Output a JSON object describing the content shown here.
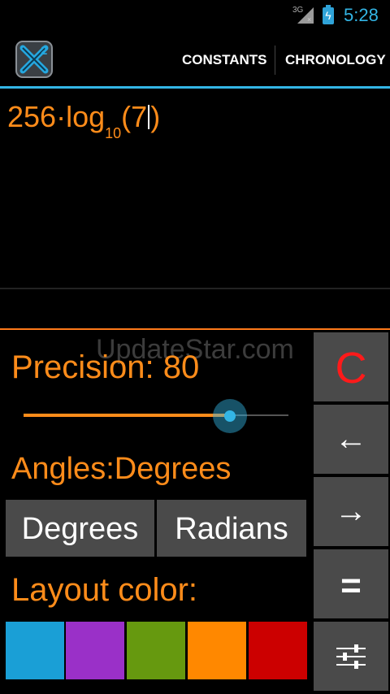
{
  "status_bar": {
    "network": "3G",
    "time": "5:28"
  },
  "action_bar": {
    "constants_label": "CONSTANTS",
    "chronology_label": "CHRONOLOGY"
  },
  "expression": {
    "coefficient": "256",
    "dot": "·",
    "func": "log",
    "base": "10",
    "open_paren": "(",
    "argument": "7",
    "close_paren": ")"
  },
  "watermark": "UpdateStar.com",
  "settings": {
    "precision_label": "Precision: 80",
    "precision_slider_fraction": 0.78,
    "angles_label": "Angles:Degrees",
    "degrees_label": "Degrees",
    "radians_label": "Radians",
    "layout_color_label": "Layout color:",
    "swatches": [
      "#1a9fd6",
      "#9a30c8",
      "#66990f",
      "#ff8800",
      "#cc0000"
    ]
  },
  "keypad": {
    "clear_label": "C",
    "left_label": "←",
    "right_label": "→",
    "equals_label": "="
  },
  "colors": {
    "accent": "#ff8c1a",
    "holo_blue": "#33b5e5"
  }
}
